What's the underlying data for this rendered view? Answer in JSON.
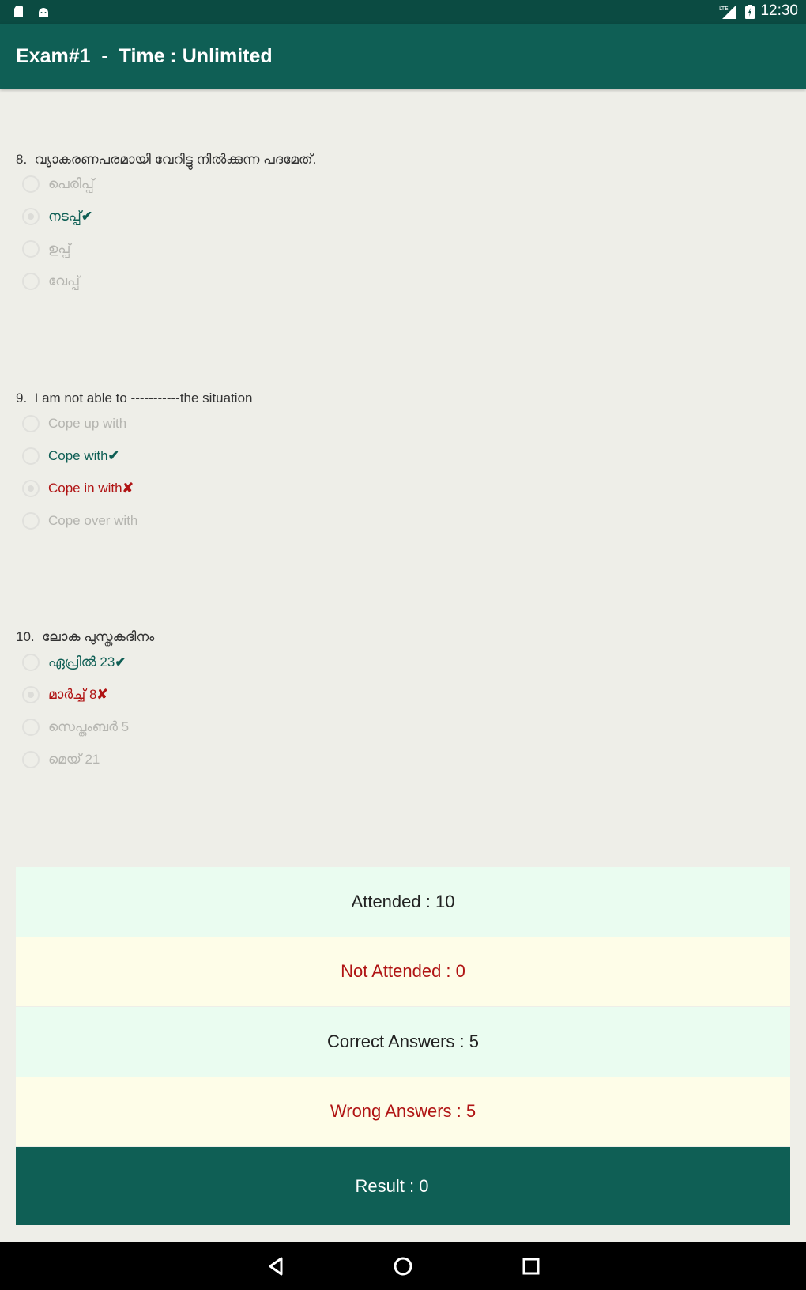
{
  "status_bar": {
    "time": "12:30",
    "left_icons": [
      "sd-card-icon",
      "android-icon"
    ],
    "right_icons": [
      "signal-lte-icon",
      "battery-icon"
    ]
  },
  "app_bar": {
    "title": "Exam#1  -  Time : Unlimited"
  },
  "questions": [
    {
      "number": "8.",
      "text": "വ്യാകരണപരമായി വേറിട്ടു നിൽക്കുന്ന പദമേത്.",
      "options": [
        {
          "label": "പെരിപ്പ്",
          "state": "disabled",
          "mark": "",
          "checked": false
        },
        {
          "label": "നടപ്പ്",
          "state": "correct",
          "mark": "✔",
          "checked": true
        },
        {
          "label": "ഉപ്പ്",
          "state": "disabled",
          "mark": "",
          "checked": false
        },
        {
          "label": "വേപ്പ്",
          "state": "disabled",
          "mark": "",
          "checked": false
        }
      ]
    },
    {
      "number": "9.",
      "text": "I am not able to -----------the situation",
      "options": [
        {
          "label": "Cope up with",
          "state": "disabled",
          "mark": "",
          "checked": false
        },
        {
          "label": "Cope with",
          "state": "correct",
          "mark": "✔",
          "checked": false
        },
        {
          "label": "Cope in with",
          "state": "wrong",
          "mark": "✘",
          "checked": true
        },
        {
          "label": "Cope over with",
          "state": "disabled",
          "mark": "",
          "checked": false
        }
      ]
    },
    {
      "number": "10.",
      "text": "ലോക പുസ്തകദിനം",
      "options": [
        {
          "label": "ഏപ്രിൽ 23",
          "state": "correct",
          "mark": "✔",
          "checked": false
        },
        {
          "label": "മാർച്ച് 8",
          "state": "wrong",
          "mark": "✘",
          "checked": true
        },
        {
          "label": "സെപ്തംബർ 5",
          "state": "disabled",
          "mark": "",
          "checked": false
        },
        {
          "label": "മെയ് 21",
          "state": "disabled",
          "mark": "",
          "checked": false
        }
      ]
    }
  ],
  "summary": {
    "attended": "Attended : 10",
    "not_attended": "Not Attended : 0",
    "correct": "Correct Answers : 5",
    "wrong": "Wrong Answers : 5",
    "result": "Result : 0"
  },
  "colors": {
    "primary": "#0f5f55",
    "primary_dark": "#0b4b42",
    "correct": "#0f5f55",
    "wrong": "#b01414",
    "disabled": "#b5b5b0"
  },
  "nav_bar": {
    "icons": [
      "back-icon",
      "home-icon",
      "recents-icon"
    ]
  }
}
